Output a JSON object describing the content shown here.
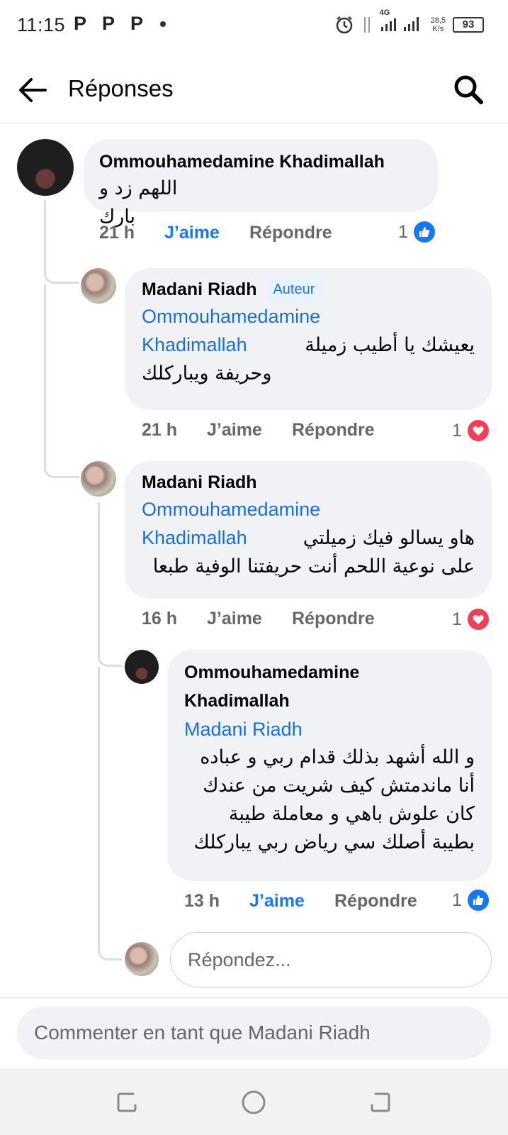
{
  "status_bar": {
    "time": "11:15",
    "notif_icons": [
      "P",
      "P",
      "P"
    ],
    "network": "4G",
    "speed_value": "28,5",
    "speed_unit": "K/s",
    "battery": "93"
  },
  "header": {
    "title": "Réponses"
  },
  "comments": [
    {
      "author": "Ommouhamedamine Khadimallah",
      "text": "اللهم زد و بارك",
      "time": "21 h",
      "like_label": "J’aime",
      "reply_label": "Répondre",
      "reaction_count": "1",
      "reaction": "like-reaction-icon"
    },
    {
      "author": "Madani Riadh",
      "badge": "Auteur",
      "mention_1": "Ommouhamedamine",
      "mention_2": "Khadimallah",
      "text_1": "يعيشك يا أطيب زميلة",
      "text_2": "وحريفة ويباركلك",
      "time": "21 h",
      "like_label": "J’aime",
      "reply_label": "Répondre",
      "reaction_count": "1",
      "reaction": "love-reaction-icon"
    },
    {
      "author": "Madani Riadh",
      "mention_1": "Ommouhamedamine",
      "mention_2": "Khadimallah",
      "text_1": "هاو يسالو فيك زميلتي",
      "text_2": "على نوعية اللحم أنت حريفتنا الوفية طبعا",
      "time": "16 h",
      "like_label": "J’aime",
      "reply_label": "Répondre",
      "reaction_count": "1",
      "reaction": "love-reaction-icon"
    },
    {
      "author_1": "Ommouhamedamine",
      "author_2": "Khadimallah",
      "mention": "Madani Riadh",
      "text_1": "و الله أشهد بذلك قدام ربي و عباده",
      "text_2": "أنا ماندمتش كيف شريت من عندك",
      "text_3": "كان علوش باهي و معاملة طيبة",
      "text_4": "بطيبة أصلك سي رياض ربي يباركلك",
      "time": "13 h",
      "like_label": "J’aime",
      "reply_label": "Répondre",
      "reaction_count": "1",
      "reaction": "like-reaction-icon"
    }
  ],
  "reply_input": {
    "placeholder": "Répondez..."
  },
  "composer": {
    "placeholder": "Commenter en tant que Madani Riadh"
  }
}
